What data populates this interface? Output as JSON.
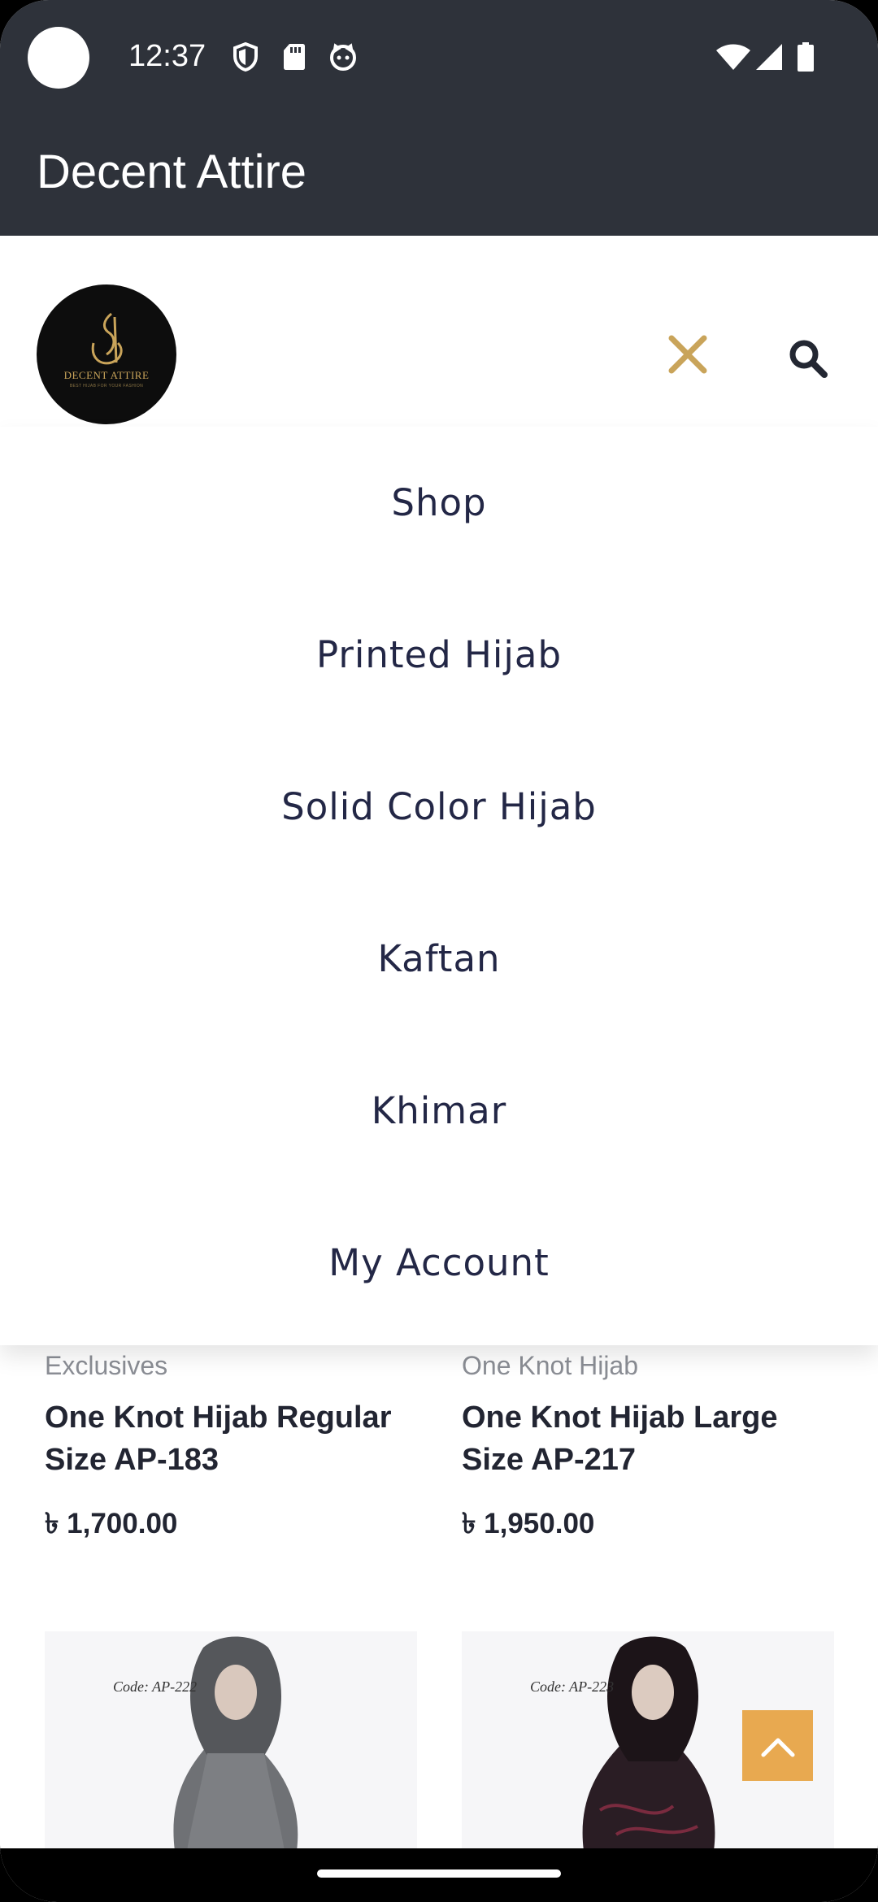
{
  "status_bar": {
    "time": "12:37"
  },
  "app_bar": {
    "title": "Decent Attire"
  },
  "site_header": {
    "logo_text": "DECENT ATTIRE",
    "logo_tagline": "BEST HIJAB FOR YOUR FASHION"
  },
  "menu": {
    "items": [
      {
        "label": "Shop"
      },
      {
        "label": "Printed Hijab"
      },
      {
        "label": "Solid Color Hijab"
      },
      {
        "label": "Kaftan"
      },
      {
        "label": "Khimar"
      },
      {
        "label": "My Account"
      }
    ]
  },
  "products": [
    {
      "category": "Exclusives",
      "name": "One Knot Hijab Regular Size AP-183",
      "price": "৳ 1,700.00"
    },
    {
      "category": "One Knot Hijab",
      "name": "One Knot Hijab Large Size AP-217",
      "price": "৳ 1,950.00"
    }
  ],
  "product_images": [
    {
      "code": "Code: AP-222"
    },
    {
      "code": "Code: AP-223"
    }
  ],
  "colors": {
    "app_bar": "#2e323a",
    "accent_gold": "#c9a45a",
    "menu_text": "#232746",
    "scroll_top": "#e8a950"
  }
}
